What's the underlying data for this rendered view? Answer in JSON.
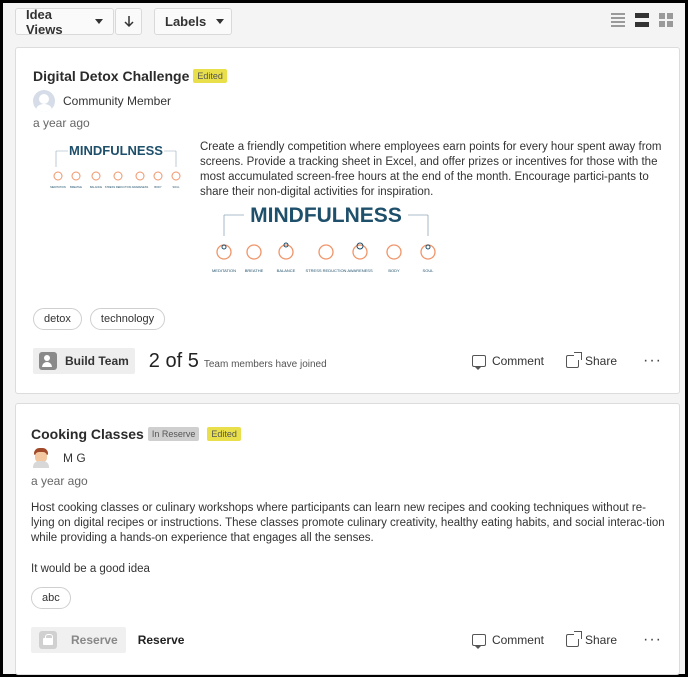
{
  "toolbar": {
    "idea_views_label": "Idea Views",
    "sort_icon": "arrow-down-icon",
    "labels_label": "Labels",
    "view_icons": [
      "list-view-icon",
      "medium-view-icon",
      "grid-view-icon"
    ]
  },
  "ideas": [
    {
      "title": "Digital Detox Challenge",
      "edited_badge": "Edited",
      "author": "Community Member",
      "date": "a year ago",
      "image_text": "MINDFULNESS",
      "image_labels": [
        "MEDITATION",
        "BREATHE",
        "BALANCE",
        "STRESS REDUCTION",
        "AWARENESS",
        "BODY",
        "SOUL"
      ],
      "description": "Create a friendly competition where employees earn points for every hour spent away from screens. Provide a tracking sheet in Excel, and offer prizes or incentives for those with the most accumulated screen-free hours at the end of the month. Encourage partici-pants to share their non-digital activities for inspiration.",
      "tags": [
        "detox",
        "technology"
      ],
      "build_team_label": "Build Team",
      "team_count": "2 of 5",
      "team_text": "Team members have joined",
      "comment_label": "Comment",
      "share_label": "Share",
      "more_label": "···"
    },
    {
      "title": "Cooking Classes",
      "reserve_badge": "In Reserve",
      "edited_badge": "Edited",
      "author": "M G",
      "date": "a year ago",
      "description": "Host cooking classes or culinary workshops where participants can learn new recipes and cooking techniques without re-lying on digital recipes or instructions. These classes promote culinary creativity, healthy eating habits, and social interac-tion while providing a hands-on experience that engages all the senses.",
      "note": "It would be a good idea",
      "tags": [
        "abc"
      ],
      "reserve_button_label": "Reserve",
      "reserve_status": "Reserve",
      "comment_label": "Comment",
      "share_label": "Share",
      "more_label": "···"
    }
  ],
  "colors": {
    "edited_badge": "#e9df4a",
    "reserve_badge": "#cfcfcf",
    "mindfulness_teal": "#1e4f6b",
    "mindfulness_orange": "#f0956a"
  }
}
